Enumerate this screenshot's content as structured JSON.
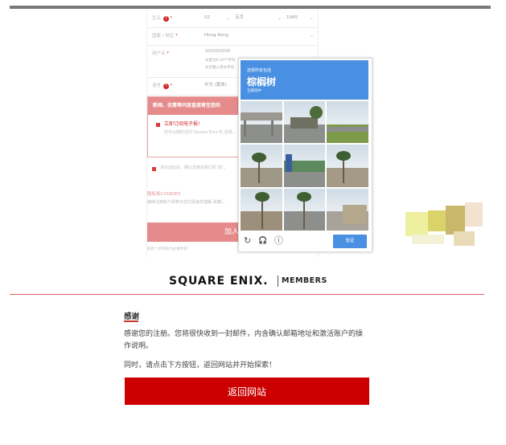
{
  "form": {
    "birthday": {
      "label": "生日",
      "day": "02",
      "month": "五月",
      "year": "1995"
    },
    "region": {
      "label": "国家 / 地区",
      "value": "Hong Kong"
    },
    "username": {
      "label": "用户名",
      "value": "000000000",
      "hint1": "长度为6-20个字符",
      "hint2": "允许输入英文字母"
    },
    "language": {
      "label": "语言",
      "value": "中文 (繁体)"
    },
    "newsletter": {
      "heading": "新闻、优惠等内容直接寄至您的",
      "subscribe": "立即订阅电子报!",
      "sub_text": "您可以随时访问 Square Enix 的 选择。"
    },
    "terms_text": "请勾选此处，确认您接受我们的 款）。",
    "privacy_title": "隐私和COOKIES",
    "privacy_text": "继续注册账户即表示您已阅读并理解 政策）。",
    "join_label": "加入",
    "footnote": "标有 * 的字段为必填字段"
  },
  "captcha": {
    "instruction": "选择所有包括",
    "object": "棕榈树",
    "footer": "全部选中",
    "verify_label": "验证",
    "reload_icon": "↻",
    "audio_icon": "🎧",
    "info_icon": "ⓘ"
  },
  "logo": {
    "brand": "SQUARE ENIX.",
    "members": "MEMBERS"
  },
  "thankyou": {
    "title": "感谢",
    "paragraph1": "感谢您的注册。您将很快收到一封邮件，内含确认邮箱地址和激活账户的操作说明。",
    "paragraph2": "同时，请点击下方按钮，返回网站并开始探索！",
    "return_button": "返回网站"
  },
  "colors": {
    "accent_red": "#cc0000",
    "captcha_blue": "#4a90e2",
    "faded_red": "#e68b8b"
  }
}
